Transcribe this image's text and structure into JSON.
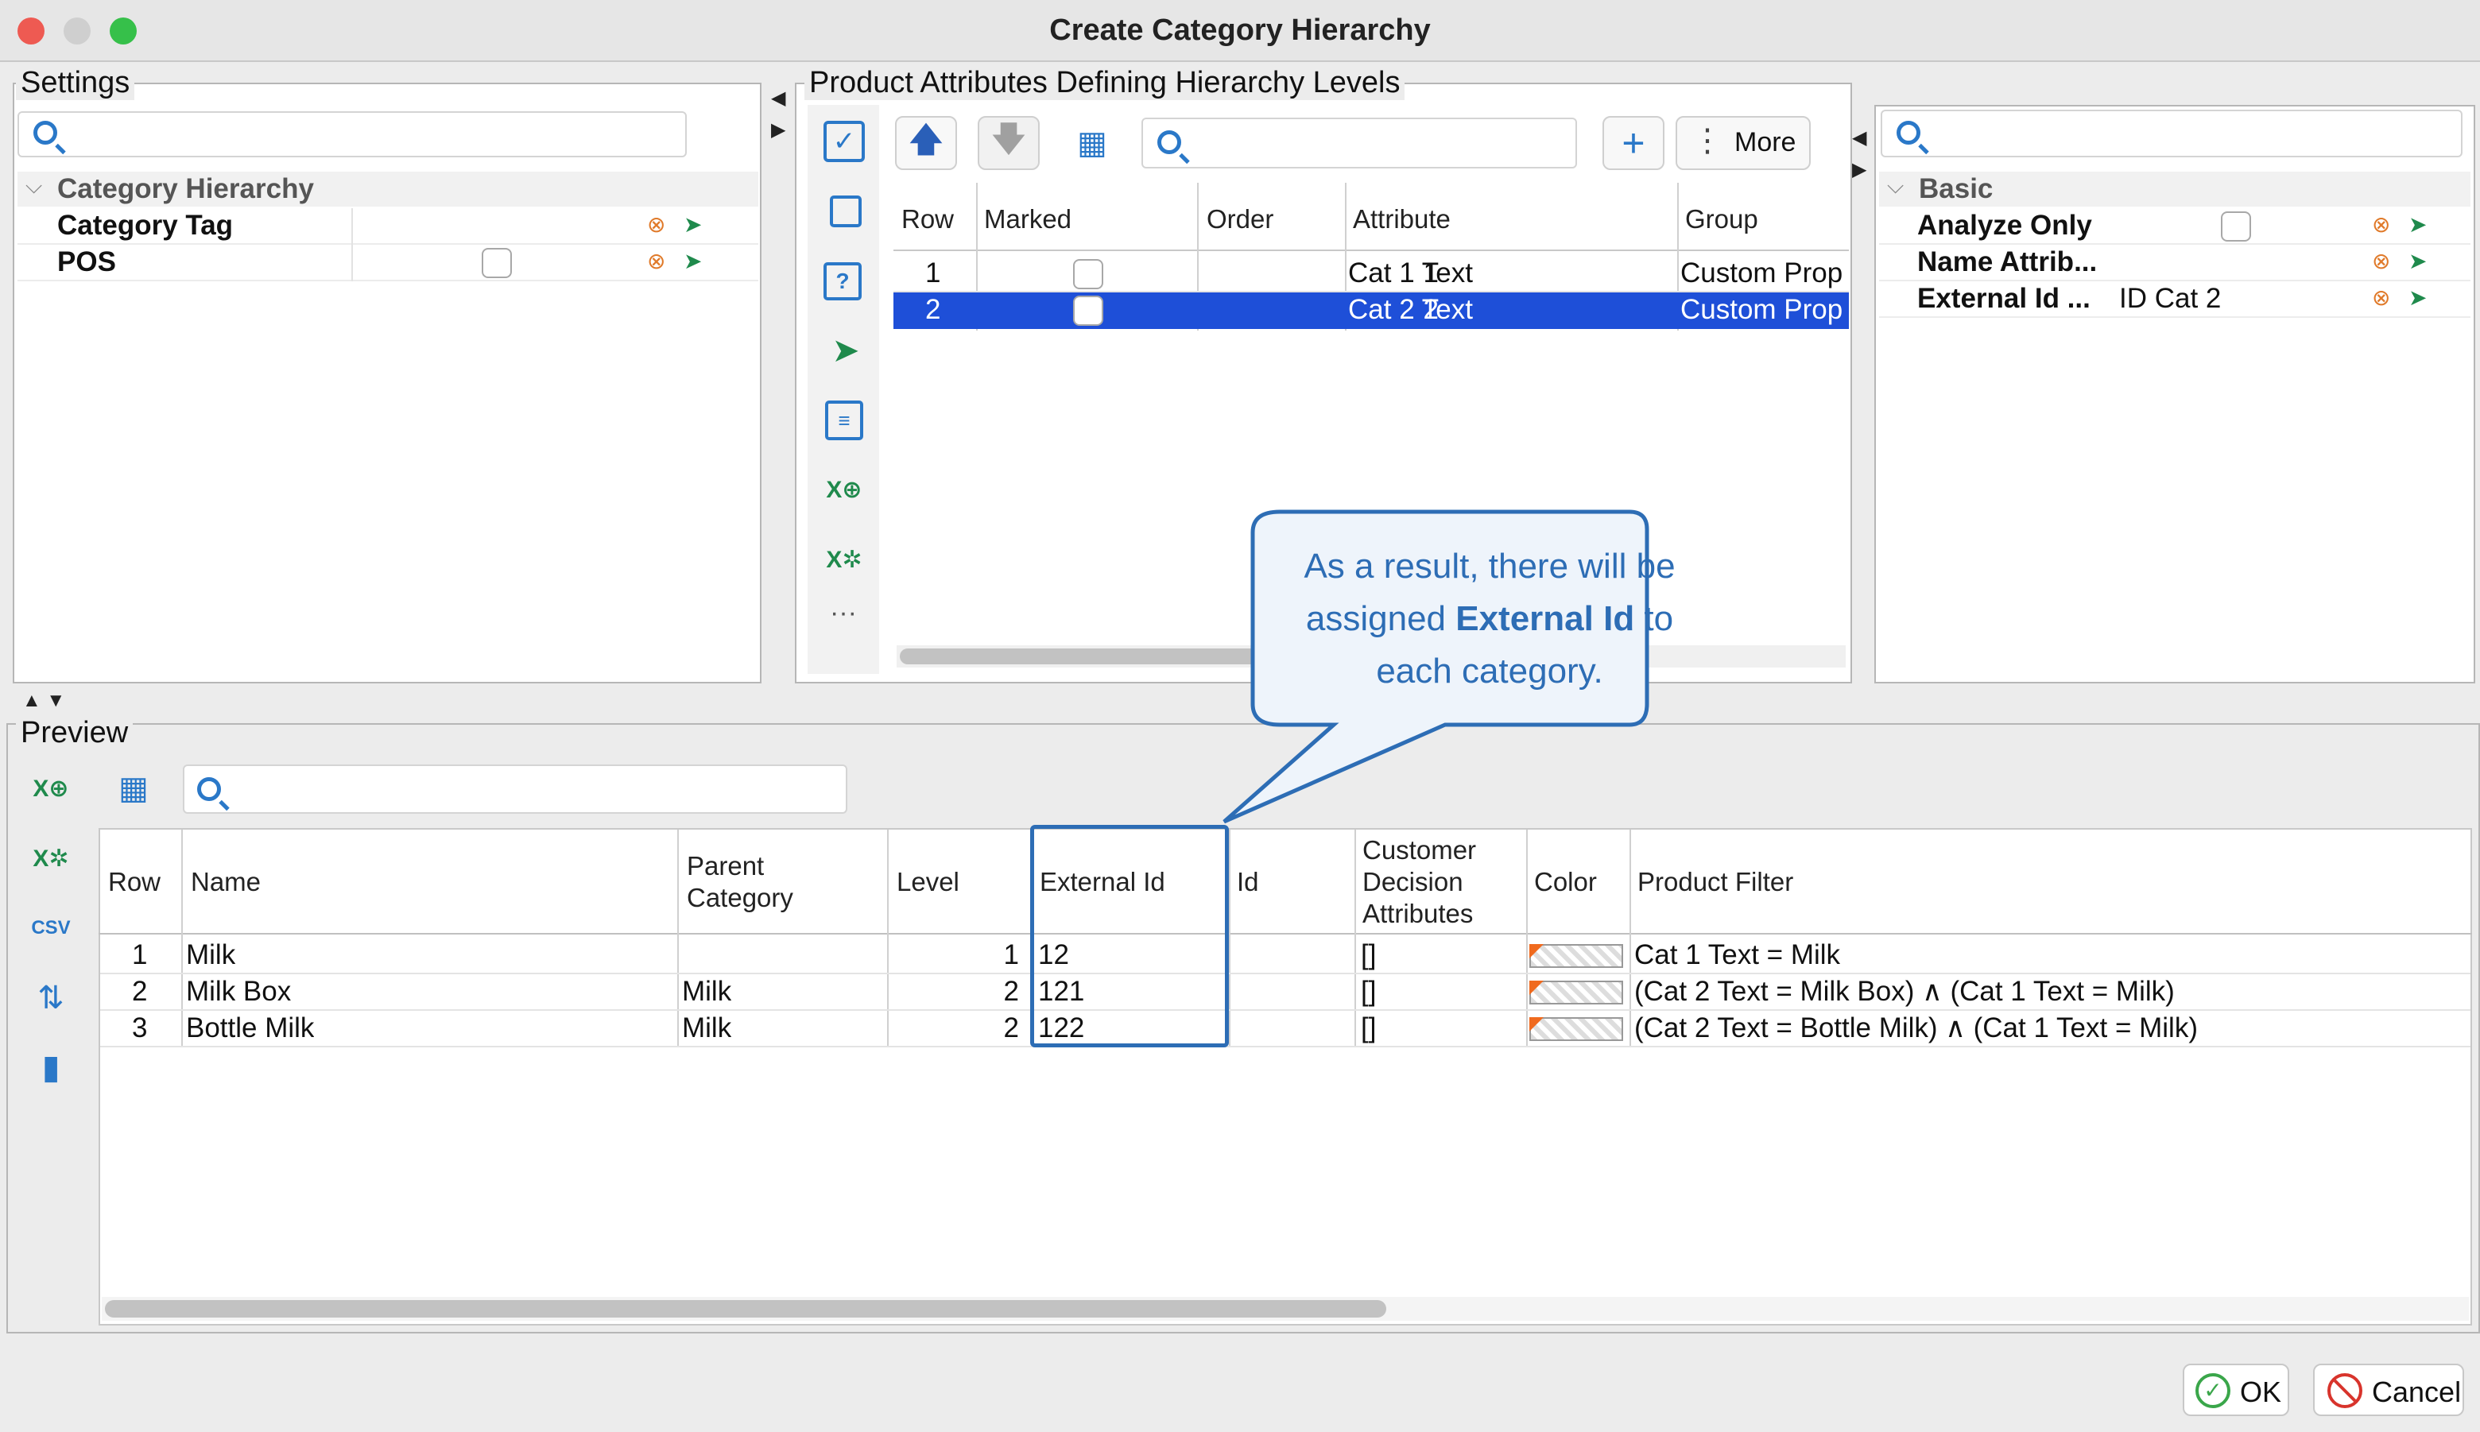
{
  "window": {
    "title": "Create Category Hierarchy"
  },
  "settings": {
    "label": "Settings",
    "search_placeholder": "",
    "group": "Category Hierarchy",
    "rows": [
      {
        "name": "Category Tag",
        "value": ""
      },
      {
        "name": "POS",
        "value": ""
      }
    ]
  },
  "attributes": {
    "label": "Product Attributes Defining Hierarchy Levels",
    "search_placeholder": "",
    "more_label": "More",
    "columns": [
      "Row",
      "Marked",
      "Order",
      "Attribute",
      "Group"
    ],
    "rows": [
      {
        "row": "1",
        "order": "1",
        "attribute": "Cat 1 Text",
        "group": "Custom Prop"
      },
      {
        "row": "2",
        "order": "2",
        "attribute": "Cat 2 Text",
        "group": "Custom Prop"
      }
    ]
  },
  "properties": {
    "search_placeholder": "",
    "group": "Basic",
    "rows": [
      {
        "name": "Analyze Only",
        "value": ""
      },
      {
        "name": "Name Attrib...",
        "value": ""
      },
      {
        "name": "External Id ...",
        "value": "ID Cat 2"
      }
    ]
  },
  "callout": {
    "part1": "As a result, there will be assigned ",
    "bold": "External Id",
    "part2": " to each category."
  },
  "preview": {
    "label": "Preview",
    "search_placeholder": "",
    "columns": {
      "row": "Row",
      "name": "Name",
      "parent_l1": "Parent",
      "parent_l2": "Category",
      "level": "Level",
      "external_id": "External Id",
      "id": "Id",
      "cda_l1": "Customer",
      "cda_l2": "Decision",
      "cda_l3": "Attributes",
      "color": "Color",
      "filter": "Product Filter"
    },
    "rows": [
      {
        "row": "1",
        "name": "Milk",
        "parent": "",
        "level": "1",
        "external_id": "12",
        "id": "",
        "cda": "[]",
        "filter": "Cat 1 Text = Milk"
      },
      {
        "row": "2",
        "name": "Milk Box",
        "parent": "Milk",
        "level": "2",
        "external_id": "121",
        "id": "",
        "cda": "[]",
        "filter": "(Cat 2 Text = Milk Box) ∧ (Cat 1 Text = Milk)"
      },
      {
        "row": "3",
        "name": "Bottle Milk",
        "parent": "Milk",
        "level": "2",
        "external_id": "122",
        "id": "",
        "cda": "[]",
        "filter": "(Cat 2 Text = Bottle Milk) ∧ (Cat 1 Text = Milk)"
      }
    ]
  },
  "buttons": {
    "ok": "OK",
    "cancel": "Cancel"
  },
  "colors": {
    "selection": "#1e4fd8",
    "accent": "#2a78c8",
    "callout_border": "#2d6db5",
    "callout_text": "#2d6db5",
    "callout_bg": "#eef4fb"
  },
  "icons": [
    "search-icon",
    "arrow-up-icon",
    "arrow-down-icon",
    "table-settings-icon",
    "add-icon",
    "more-icon",
    "ok-icon",
    "cancel-icon",
    "check-list-icon",
    "copy-icon",
    "help-icon",
    "pointer-icon",
    "clipboard-icon",
    "excel-export-icon",
    "excel-settings-icon",
    "csv-icon",
    "chart-icon"
  ]
}
